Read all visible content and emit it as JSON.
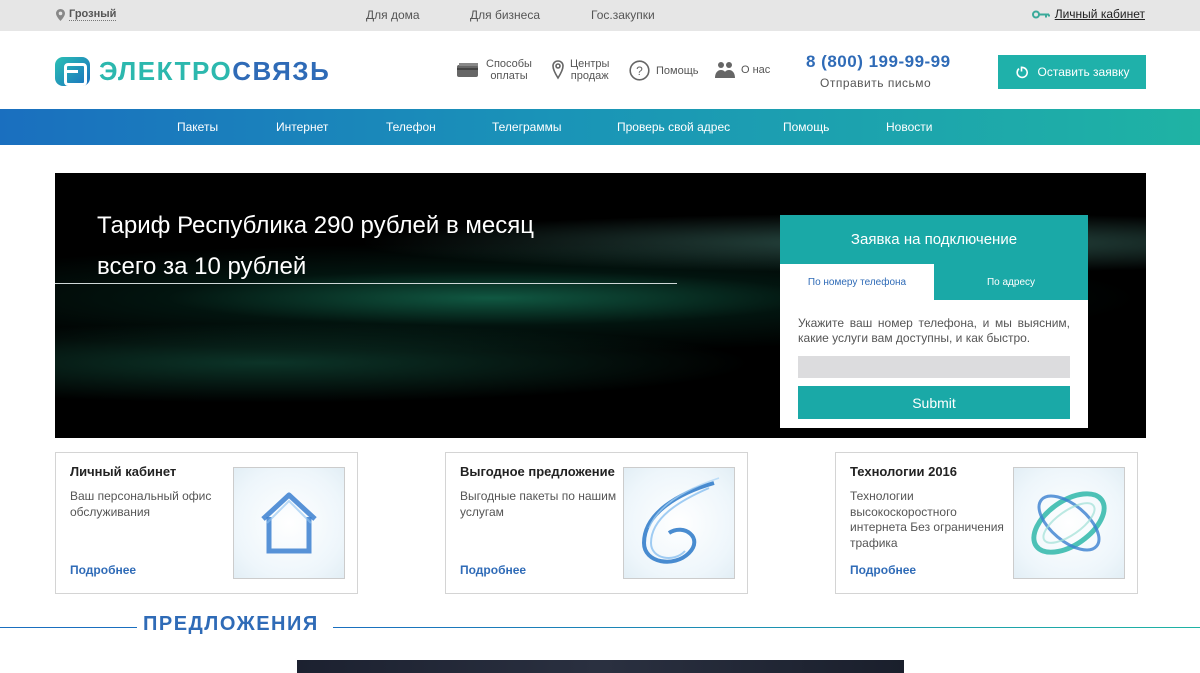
{
  "topbar": {
    "city": "Грозный",
    "nav": [
      "Для дома",
      "Для бизнеса",
      "Гос.закупки"
    ],
    "cabinet": "Личный кабинет"
  },
  "header": {
    "logo_part1": "ЭЛЕКТРО",
    "logo_part2": "СВЯЗЬ",
    "links": [
      {
        "label_line1": "Способы",
        "label_line2": "оплаты",
        "icon": "card-icon"
      },
      {
        "label_line1": "Центры",
        "label_line2": "продаж",
        "icon": "pin-icon"
      },
      {
        "label_line1": "Помощь",
        "label_line2": "",
        "icon": "question-icon"
      },
      {
        "label_line1": "О нас",
        "label_line2": "",
        "icon": "people-icon"
      }
    ],
    "phone": "8 (800) 199-99-99",
    "mail": "Отправить письмо",
    "order_button": "Оставить заявку"
  },
  "mainnav": [
    "Пакеты",
    "Интернет",
    "Телефон",
    "Телеграммы",
    "Проверь свой адрес",
    "Помощь",
    "Новости"
  ],
  "hero": {
    "title_line1": "Тариф Республика 290 рублей в месяц",
    "title_line2": "всего за 10 рублей"
  },
  "form": {
    "title": "Заявка на подключение",
    "tab_phone": "По номеру телефона",
    "tab_address": "По адресу",
    "text": "Укажите ваш номер телефона, и мы выясним, какие услуги вам доступны, и как быстро.",
    "submit": "Submit"
  },
  "cards": [
    {
      "title": "Личный кабинет",
      "desc": "Ваш персональный офис обслуживания",
      "more": "Подробнее"
    },
    {
      "title": "Выгодное предложение",
      "desc": "Выгодные пакеты по нашим услугам",
      "more": "Подробнее"
    },
    {
      "title": "Технологии 2016",
      "desc": "Технологии высокоскоростного интернета Без ограничения трафика",
      "more": "Подробнее"
    }
  ],
  "section": {
    "title": "ПРЕДЛОЖЕНИЯ"
  },
  "colors": {
    "brand_blue": "#2f6bb7",
    "brand_teal": "#1aa9a7",
    "topbar_bg": "#e6e6e6"
  }
}
